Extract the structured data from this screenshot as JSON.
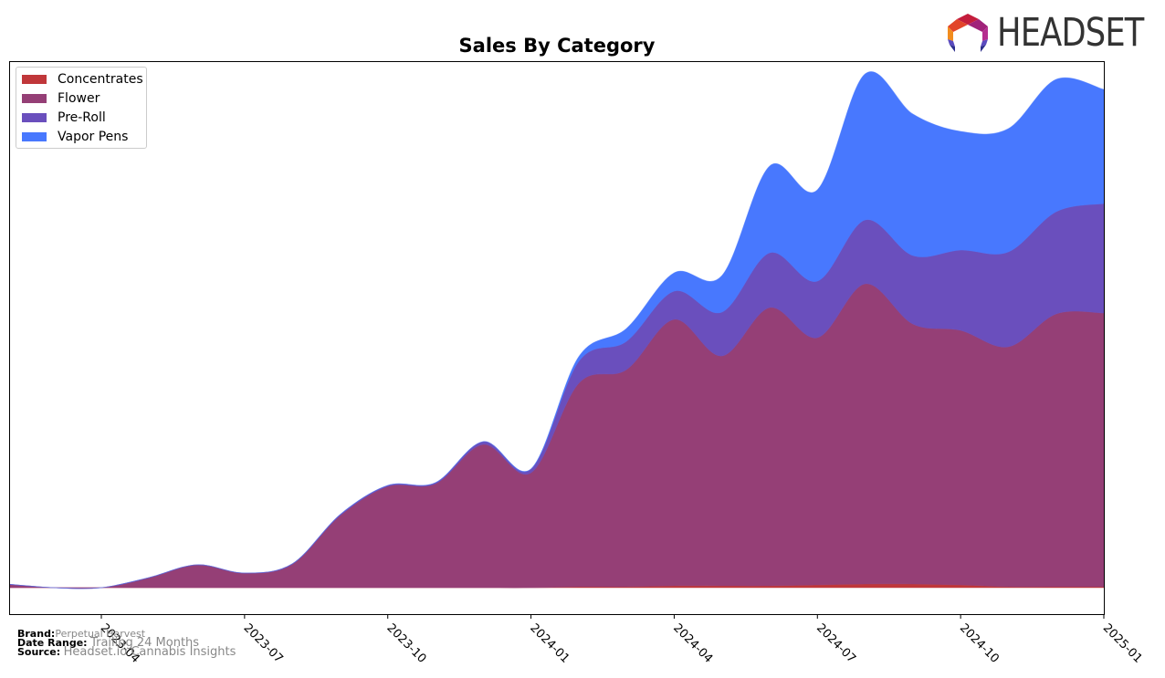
{
  "logo": {
    "text": "HEADSET",
    "icon": "headset-logo-icon"
  },
  "footer": {
    "brand_label": "Brand:",
    "brand_value": "Perpetual Harvest",
    "date_range_label": "Date Range:",
    "date_range_value": "Trailing 24 Months",
    "source_label": "Source:",
    "source_value": "Headset.io Cannabis Insights"
  },
  "chart_data": {
    "type": "area",
    "stacked": true,
    "title": "Sales By Category",
    "xlabel": "",
    "ylabel": "",
    "y_ticks_shown": false,
    "grid": false,
    "legend_position": "top-left",
    "x_tick_labels": [
      "2023-04",
      "2023-07",
      "2023-10",
      "2024-01",
      "2024-04",
      "2024-07",
      "2024-10",
      "2025-01"
    ],
    "x": [
      "2023-02",
      "2023-03",
      "2023-04",
      "2023-05",
      "2023-06",
      "2023-07",
      "2023-08",
      "2023-09",
      "2023-10",
      "2023-11",
      "2023-12",
      "2024-01",
      "2024-02",
      "2024-03",
      "2024-04",
      "2024-05",
      "2024-06",
      "2024-07",
      "2024-08",
      "2024-09",
      "2024-10",
      "2024-11",
      "2024-12",
      "2025-01"
    ],
    "ylim": [
      0,
      600
    ],
    "series": [
      {
        "name": "Concentrates",
        "color": "#c0373a",
        "values": [
          0,
          0,
          0,
          0,
          0,
          0,
          0,
          0,
          0,
          0,
          0,
          0,
          1,
          1,
          2,
          2,
          2,
          3,
          4,
          4,
          3,
          1,
          1,
          1
        ]
      },
      {
        "name": "Flower",
        "color": "#953f76",
        "values": [
          4,
          0,
          0,
          11,
          25,
          16,
          26,
          79,
          111,
          114,
          157,
          126,
          223,
          238,
          292,
          252,
          305,
          271,
          329,
          285,
          279,
          263,
          299,
          300
        ]
      },
      {
        "name": "Pre-Roll",
        "color": "#6a4fbd",
        "values": [
          0,
          0,
          0,
          0,
          0,
          0,
          0,
          1,
          1,
          1,
          3,
          4,
          24,
          31,
          31,
          48,
          60,
          62,
          70,
          75,
          88,
          104,
          112,
          120
        ]
      },
      {
        "name": "Vapor Pens",
        "color": "#4878fe",
        "values": [
          0,
          0,
          0,
          0,
          0,
          0,
          0,
          0,
          0,
          0,
          0,
          0,
          5,
          14,
          20,
          40,
          95,
          100,
          160,
          155,
          130,
          135,
          145,
          125
        ]
      }
    ]
  }
}
